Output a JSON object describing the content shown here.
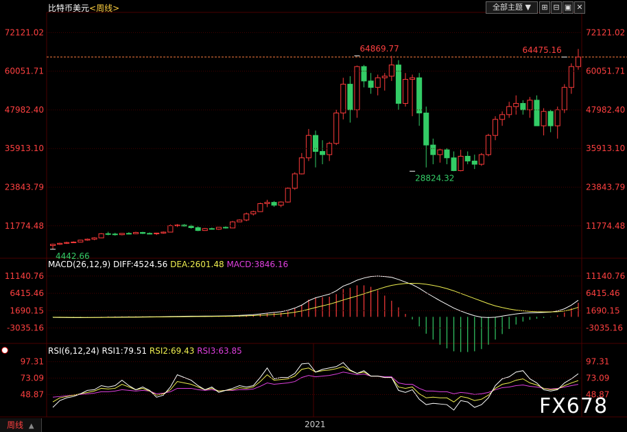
{
  "header": {
    "title": "比特币美元",
    "period": "<周线>",
    "theme_label": "全部主题 ▼"
  },
  "watermark": "FX678",
  "footer": {
    "period": "周线",
    "arrow": "▲",
    "year": "2021"
  },
  "colors": {
    "up": "#ff3b3b",
    "down": "#33cc66",
    "grid": "#4a0000",
    "axis": "#ff4040",
    "diff": "#ffffff",
    "dea": "#f0f050",
    "macd": "#e040e0",
    "rsi1": "#ffffff",
    "rsi2": "#f0f050",
    "rsi3": "#e040e0",
    "dash": "#ff8040"
  },
  "chart_data": [
    {
      "type": "candlestick",
      "title": "比特币美元",
      "y_ticks": [
        "72121.02",
        "60051.71",
        "47982.40",
        "35913.10",
        "23843.79",
        "11774.48"
      ],
      "y_tick_values": [
        72121.02,
        60051.71,
        47982.4,
        35913.1,
        23843.79,
        11774.48
      ],
      "ylim": [
        2500,
        78000
      ],
      "annotations": [
        {
          "text": "64869.77",
          "value": 64869.77,
          "index": 44,
          "side": "right",
          "color": "#ff4040"
        },
        {
          "text": "64475.16",
          "value": 64475.16,
          "index": 74,
          "side": "left",
          "color": "#ff4040"
        },
        {
          "text": "28824.32",
          "value": 28824.32,
          "index": 52,
          "side": "right",
          "color": "#33cc66"
        },
        {
          "text": "4442.66",
          "value": 4442.66,
          "index": 0,
          "side": "right",
          "color": "#33cc66"
        }
      ],
      "reference_line": 64475.16,
      "ohlc": [
        [
          5600,
          6200,
          4442.66,
          6000
        ],
        [
          6000,
          6500,
          5800,
          6300
        ],
        [
          6300,
          6800,
          6100,
          6550
        ],
        [
          6550,
          6900,
          6400,
          6700
        ],
        [
          6700,
          7400,
          6600,
          7300
        ],
        [
          7300,
          7800,
          7100,
          7600
        ],
        [
          7600,
          8200,
          7300,
          8000
        ],
        [
          8000,
          9500,
          7900,
          9300
        ],
        [
          9300,
          9900,
          8800,
          9200
        ],
        [
          9200,
          9600,
          8700,
          9000
        ],
        [
          9000,
          9500,
          8800,
          9400
        ],
        [
          9400,
          9800,
          9100,
          9300
        ],
        [
          9300,
          9900,
          9200,
          9700
        ],
        [
          9700,
          9900,
          9200,
          9400
        ],
        [
          9400,
          9700,
          9100,
          9300
        ],
        [
          9300,
          9600,
          8900,
          9500
        ],
        [
          9500,
          10000,
          9300,
          9800
        ],
        [
          9800,
          12200,
          9700,
          11800
        ],
        [
          11800,
          12300,
          11400,
          12000
        ],
        [
          12000,
          12300,
          11500,
          11700
        ],
        [
          11700,
          12100,
          10900,
          11200
        ],
        [
          11200,
          11600,
          10100,
          10300
        ],
        [
          10300,
          11100,
          10200,
          10900
        ],
        [
          10900,
          11200,
          10600,
          10700
        ],
        [
          10700,
          11400,
          10500,
          11300
        ],
        [
          11300,
          11600,
          10900,
          11100
        ],
        [
          11100,
          13300,
          11000,
          13000
        ],
        [
          13000,
          13800,
          12900,
          13600
        ],
        [
          13600,
          15900,
          13200,
          15500
        ],
        [
          15500,
          16500,
          15000,
          16200
        ],
        [
          16200,
          19000,
          16100,
          18700
        ],
        [
          18700,
          19900,
          17600,
          19100
        ],
        [
          19100,
          19500,
          17700,
          18200
        ],
        [
          18200,
          19400,
          17600,
          19200
        ],
        [
          19200,
          23800,
          19000,
          23500
        ],
        [
          23500,
          28500,
          23000,
          28000
        ],
        [
          28000,
          34500,
          27800,
          33000
        ],
        [
          33000,
          42000,
          32000,
          40000
        ],
        [
          40000,
          41500,
          30000,
          35000
        ],
        [
          35000,
          38500,
          31000,
          34000
        ],
        [
          34000,
          38000,
          32000,
          37500
        ],
        [
          37500,
          48000,
          37000,
          47000
        ],
        [
          47000,
          58000,
          45000,
          56000
        ],
        [
          56000,
          58500,
          44000,
          48000
        ],
        [
          48000,
          61800,
          45500,
          61500
        ],
        [
          61500,
          62000,
          55000,
          57000
        ],
        [
          57000,
          59500,
          53000,
          55000
        ],
        [
          55000,
          59000,
          52500,
          58000
        ],
        [
          58000,
          59500,
          54000,
          58500
        ],
        [
          58500,
          64869.77,
          57000,
          62000
        ],
        [
          62000,
          63500,
          48000,
          50000
        ],
        [
          50000,
          59500,
          49000,
          57500
        ],
        [
          57500,
          59000,
          46000,
          58000
        ],
        [
          58000,
          59500,
          43000,
          47000
        ],
        [
          47000,
          49000,
          30000,
          37000
        ],
        [
          37000,
          39000,
          31000,
          34000
        ],
        [
          34000,
          36000,
          31500,
          35500
        ],
        [
          35500,
          36000,
          31000,
          33000
        ],
        [
          33000,
          35000,
          28824.32,
          29000
        ],
        [
          29000,
          35500,
          28800,
          33500
        ],
        [
          33500,
          35000,
          31000,
          32000
        ],
        [
          32000,
          34000,
          29500,
          31000
        ],
        [
          31000,
          34500,
          30500,
          34000
        ],
        [
          34000,
          40500,
          33500,
          40000
        ],
        [
          40000,
          46000,
          38500,
          45000
        ],
        [
          45000,
          47500,
          43000,
          46500
        ],
        [
          46500,
          50500,
          45500,
          49000
        ],
        [
          49000,
          52500,
          46500,
          50000
        ],
        [
          50000,
          51000,
          46500,
          48000
        ],
        [
          48000,
          52000,
          45500,
          51000
        ],
        [
          51000,
          52500,
          46000,
          43000
        ],
        [
          43000,
          48500,
          40000,
          47500
        ],
        [
          47500,
          48000,
          41000,
          43000
        ],
        [
          43000,
          49000,
          39000,
          48000
        ],
        [
          48000,
          56000,
          47000,
          55000
        ],
        [
          55000,
          62500,
          53000,
          61500
        ],
        [
          61500,
          67000,
          60500,
          64475.16
        ]
      ]
    },
    {
      "type": "line",
      "title": "MACD(26,12,9)",
      "legend": [
        {
          "name": "DIFF",
          "label": "DIFF:4524.56"
        },
        {
          "name": "DEA",
          "label": "DEA:2601.48"
        },
        {
          "name": "MACD",
          "label": "MACD:3846.16"
        }
      ],
      "y_ticks": [
        "11140.76",
        "6415.46",
        "1690.15",
        "-3035.16"
      ],
      "y_tick_values": [
        11140.76,
        6415.46,
        1690.15,
        -3035.16
      ],
      "ylim": [
        -6500,
        13000
      ],
      "diff": [
        -150,
        -180,
        -200,
        -220,
        -220,
        -200,
        -180,
        -140,
        -100,
        -80,
        -60,
        -40,
        -20,
        0,
        10,
        20,
        40,
        80,
        120,
        150,
        170,
        180,
        200,
        210,
        230,
        250,
        300,
        380,
        480,
        600,
        800,
        1000,
        1200,
        1400,
        1800,
        2400,
        3200,
        4400,
        5200,
        5700,
        6200,
        7100,
        8400,
        9100,
        10000,
        10600,
        11000,
        11140,
        11000,
        10800,
        10200,
        9500,
        8800,
        7800,
        6600,
        5500,
        4400,
        3400,
        2400,
        1600,
        900,
        300,
        -100,
        -200,
        -100,
        200,
        500,
        800,
        1000,
        1100,
        1150,
        1200,
        1300,
        1600,
        2200,
        3200,
        4524.56
      ],
      "dea": [
        -100,
        -110,
        -130,
        -150,
        -160,
        -170,
        -172,
        -165,
        -155,
        -140,
        -125,
        -110,
        -90,
        -70,
        -55,
        -40,
        -25,
        -5,
        15,
        35,
        55,
        75,
        90,
        110,
        130,
        150,
        180,
        220,
        270,
        340,
        430,
        540,
        670,
        820,
        1000,
        1250,
        1600,
        2050,
        2550,
        3000,
        3450,
        4000,
        4600,
        5150,
        5700,
        6300,
        6900,
        7500,
        8100,
        8600,
        8900,
        9100,
        9150,
        9100,
        8900,
        8600,
        8200,
        7700,
        7100,
        6400,
        5700,
        5000,
        4300,
        3600,
        3000,
        2550,
        2150,
        1850,
        1650,
        1500,
        1400,
        1350,
        1350,
        1400,
        1600,
        2000,
        2601.48
      ]
    },
    {
      "type": "line",
      "title": "RSI(6,12,24)",
      "legend": [
        {
          "name": "RSI1",
          "label": "RSI1:79.51"
        },
        {
          "name": "RSI2",
          "label": "RSI2:69.43"
        },
        {
          "name": "RSI3",
          "label": "RSI3:63.85"
        }
      ],
      "y_ticks": [
        "97.31",
        "73.09",
        "48.87"
      ],
      "y_tick_values": [
        97.31,
        73.09,
        48.87
      ],
      "ylim": [
        18,
        108
      ],
      "rsi1": [
        30,
        40,
        44,
        46,
        50,
        55,
        56,
        62,
        60,
        62,
        70,
        62,
        56,
        60,
        55,
        45,
        48,
        60,
        78,
        74,
        70,
        62,
        56,
        60,
        52,
        55,
        58,
        62,
        60,
        62,
        74,
        88,
        72,
        74,
        74,
        80,
        94,
        95,
        82,
        86,
        88,
        90,
        96,
        85,
        80,
        84,
        76,
        76,
        74,
        74,
        55,
        52,
        56,
        42,
        34,
        36,
        35,
        34,
        26,
        40,
        38,
        30,
        34,
        44,
        62,
        72,
        75,
        82,
        84,
        72,
        66,
        56,
        54,
        56,
        66,
        72,
        79.51
      ],
      "rsi2": [
        38,
        44,
        46,
        48,
        50,
        52,
        54,
        58,
        57,
        58,
        64,
        60,
        56,
        58,
        54,
        48,
        50,
        56,
        68,
        66,
        64,
        60,
        56,
        58,
        54,
        55,
        56,
        59,
        58,
        60,
        68,
        78,
        70,
        71,
        72,
        76,
        86,
        88,
        82,
        84,
        85,
        87,
        90,
        84,
        80,
        82,
        76,
        76,
        74,
        74,
        60,
        58,
        60,
        50,
        44,
        45,
        44,
        44,
        38,
        46,
        44,
        40,
        42,
        48,
        58,
        64,
        66,
        70,
        72,
        66,
        63,
        58,
        56,
        57,
        62,
        66,
        69.43
      ],
      "rsi3": [
        45,
        46,
        47,
        48,
        49,
        50,
        51,
        53,
        53,
        54,
        56,
        55,
        54,
        55,
        54,
        50,
        51,
        53,
        58,
        58,
        58,
        56,
        55,
        56,
        54,
        55,
        55,
        56,
        56,
        57,
        61,
        66,
        64,
        65,
        66,
        68,
        74,
        77,
        75,
        76,
        77,
        79,
        82,
        80,
        78,
        79,
        76,
        76,
        75,
        75,
        66,
        64,
        64,
        58,
        54,
        54,
        53,
        53,
        50,
        52,
        51,
        49,
        50,
        52,
        56,
        59,
        60,
        62,
        63,
        61,
        60,
        58,
        57,
        58,
        60,
        62,
        63.85
      ]
    }
  ]
}
